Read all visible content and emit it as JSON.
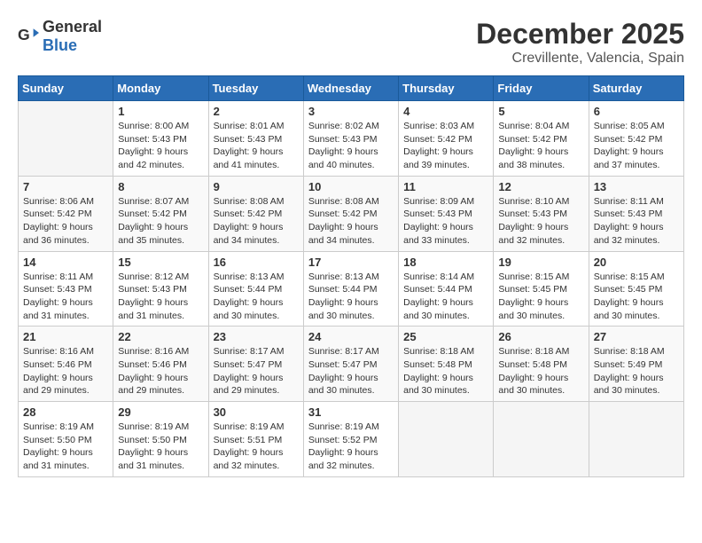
{
  "header": {
    "logo_general": "General",
    "logo_blue": "Blue",
    "title": "December 2025",
    "subtitle": "Crevillente, Valencia, Spain"
  },
  "weekdays": [
    "Sunday",
    "Monday",
    "Tuesday",
    "Wednesday",
    "Thursday",
    "Friday",
    "Saturday"
  ],
  "weeks": [
    [
      {
        "day": "",
        "info": ""
      },
      {
        "day": "1",
        "info": "Sunrise: 8:00 AM\nSunset: 5:43 PM\nDaylight: 9 hours\nand 42 minutes."
      },
      {
        "day": "2",
        "info": "Sunrise: 8:01 AM\nSunset: 5:43 PM\nDaylight: 9 hours\nand 41 minutes."
      },
      {
        "day": "3",
        "info": "Sunrise: 8:02 AM\nSunset: 5:43 PM\nDaylight: 9 hours\nand 40 minutes."
      },
      {
        "day": "4",
        "info": "Sunrise: 8:03 AM\nSunset: 5:42 PM\nDaylight: 9 hours\nand 39 minutes."
      },
      {
        "day": "5",
        "info": "Sunrise: 8:04 AM\nSunset: 5:42 PM\nDaylight: 9 hours\nand 38 minutes."
      },
      {
        "day": "6",
        "info": "Sunrise: 8:05 AM\nSunset: 5:42 PM\nDaylight: 9 hours\nand 37 minutes."
      }
    ],
    [
      {
        "day": "7",
        "info": "Sunrise: 8:06 AM\nSunset: 5:42 PM\nDaylight: 9 hours\nand 36 minutes."
      },
      {
        "day": "8",
        "info": "Sunrise: 8:07 AM\nSunset: 5:42 PM\nDaylight: 9 hours\nand 35 minutes."
      },
      {
        "day": "9",
        "info": "Sunrise: 8:08 AM\nSunset: 5:42 PM\nDaylight: 9 hours\nand 34 minutes."
      },
      {
        "day": "10",
        "info": "Sunrise: 8:08 AM\nSunset: 5:42 PM\nDaylight: 9 hours\nand 34 minutes."
      },
      {
        "day": "11",
        "info": "Sunrise: 8:09 AM\nSunset: 5:43 PM\nDaylight: 9 hours\nand 33 minutes."
      },
      {
        "day": "12",
        "info": "Sunrise: 8:10 AM\nSunset: 5:43 PM\nDaylight: 9 hours\nand 32 minutes."
      },
      {
        "day": "13",
        "info": "Sunrise: 8:11 AM\nSunset: 5:43 PM\nDaylight: 9 hours\nand 32 minutes."
      }
    ],
    [
      {
        "day": "14",
        "info": "Sunrise: 8:11 AM\nSunset: 5:43 PM\nDaylight: 9 hours\nand 31 minutes."
      },
      {
        "day": "15",
        "info": "Sunrise: 8:12 AM\nSunset: 5:43 PM\nDaylight: 9 hours\nand 31 minutes."
      },
      {
        "day": "16",
        "info": "Sunrise: 8:13 AM\nSunset: 5:44 PM\nDaylight: 9 hours\nand 30 minutes."
      },
      {
        "day": "17",
        "info": "Sunrise: 8:13 AM\nSunset: 5:44 PM\nDaylight: 9 hours\nand 30 minutes."
      },
      {
        "day": "18",
        "info": "Sunrise: 8:14 AM\nSunset: 5:44 PM\nDaylight: 9 hours\nand 30 minutes."
      },
      {
        "day": "19",
        "info": "Sunrise: 8:15 AM\nSunset: 5:45 PM\nDaylight: 9 hours\nand 30 minutes."
      },
      {
        "day": "20",
        "info": "Sunrise: 8:15 AM\nSunset: 5:45 PM\nDaylight: 9 hours\nand 30 minutes."
      }
    ],
    [
      {
        "day": "21",
        "info": "Sunrise: 8:16 AM\nSunset: 5:46 PM\nDaylight: 9 hours\nand 29 minutes."
      },
      {
        "day": "22",
        "info": "Sunrise: 8:16 AM\nSunset: 5:46 PM\nDaylight: 9 hours\nand 29 minutes."
      },
      {
        "day": "23",
        "info": "Sunrise: 8:17 AM\nSunset: 5:47 PM\nDaylight: 9 hours\nand 29 minutes."
      },
      {
        "day": "24",
        "info": "Sunrise: 8:17 AM\nSunset: 5:47 PM\nDaylight: 9 hours\nand 30 minutes."
      },
      {
        "day": "25",
        "info": "Sunrise: 8:18 AM\nSunset: 5:48 PM\nDaylight: 9 hours\nand 30 minutes."
      },
      {
        "day": "26",
        "info": "Sunrise: 8:18 AM\nSunset: 5:48 PM\nDaylight: 9 hours\nand 30 minutes."
      },
      {
        "day": "27",
        "info": "Sunrise: 8:18 AM\nSunset: 5:49 PM\nDaylight: 9 hours\nand 30 minutes."
      }
    ],
    [
      {
        "day": "28",
        "info": "Sunrise: 8:19 AM\nSunset: 5:50 PM\nDaylight: 9 hours\nand 31 minutes."
      },
      {
        "day": "29",
        "info": "Sunrise: 8:19 AM\nSunset: 5:50 PM\nDaylight: 9 hours\nand 31 minutes."
      },
      {
        "day": "30",
        "info": "Sunrise: 8:19 AM\nSunset: 5:51 PM\nDaylight: 9 hours\nand 32 minutes."
      },
      {
        "day": "31",
        "info": "Sunrise: 8:19 AM\nSunset: 5:52 PM\nDaylight: 9 hours\nand 32 minutes."
      },
      {
        "day": "",
        "info": ""
      },
      {
        "day": "",
        "info": ""
      },
      {
        "day": "",
        "info": ""
      }
    ]
  ]
}
